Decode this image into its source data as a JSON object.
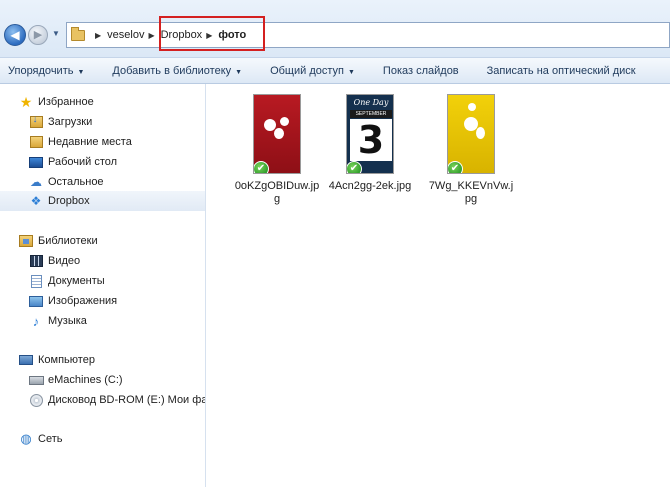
{
  "breadcrumb": {
    "items": [
      "veselov",
      "Dropbox",
      "фото"
    ]
  },
  "toolbar": {
    "organize": "Упорядочить",
    "add_to_library": "Добавить в библиотеку",
    "share": "Общий доступ",
    "slideshow": "Показ слайдов",
    "burn": "Записать на оптический диск"
  },
  "sidebar": {
    "favorites": {
      "title": "Избранное",
      "items": [
        "Загрузки",
        "Недавние места",
        "Рабочий стол",
        "Остальное",
        "Dropbox"
      ]
    },
    "libraries": {
      "title": "Библиотеки",
      "items": [
        "Видео",
        "Документы",
        "Изображения",
        "Музыка"
      ]
    },
    "computer": {
      "title": "Компьютер",
      "items": [
        "eMachines (C:)",
        "Дисковод BD-ROM (E:) Мои фа"
      ]
    },
    "network": {
      "title": "Сеть"
    }
  },
  "files": [
    {
      "name": "0oKZgOBIDuw.jpg",
      "thumb": "red",
      "status": "synced"
    },
    {
      "name": "4Acn2gg-2ek.jpg",
      "thumb": "blue",
      "status": "synced",
      "thumb_text": {
        "top": "One Day",
        "label": "SEPTEMBER",
        "number": "3"
      }
    },
    {
      "name": "7Wg_KKEVnVw.jpg",
      "thumb": "yellow",
      "status": "synced"
    }
  ],
  "colors": {
    "highlight_box": "#d42020",
    "toolbar_text": "#1e395b",
    "sync_check": "#2f9e2c"
  }
}
